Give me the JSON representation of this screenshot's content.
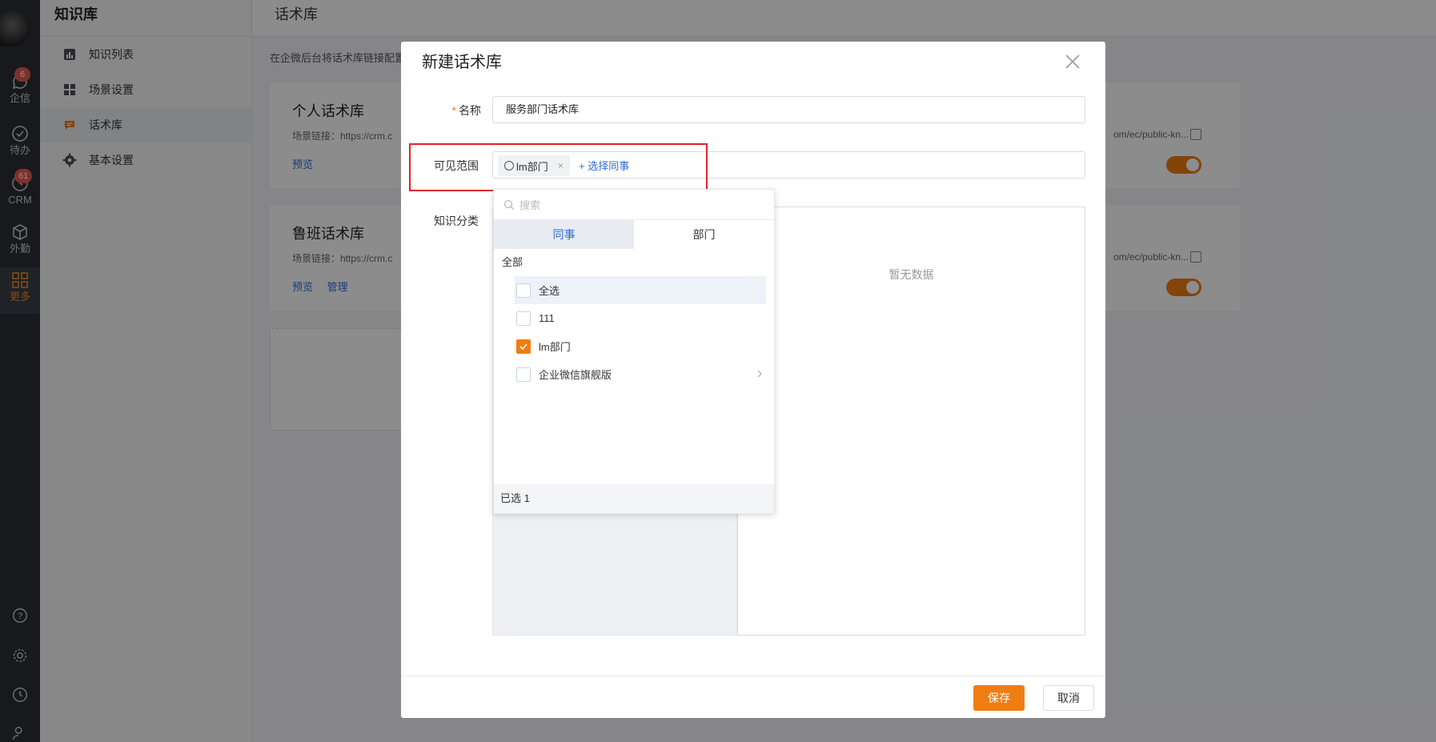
{
  "rail": {
    "items": [
      {
        "label": "企信",
        "icon": "chat-icon",
        "badge": "6"
      },
      {
        "label": "待办",
        "icon": "check-icon",
        "badge": ""
      },
      {
        "label": "CRM",
        "icon": "clock-icon",
        "badge": "61"
      },
      {
        "label": "外勤",
        "icon": "box-icon",
        "badge": ""
      },
      {
        "label": "更多",
        "icon": "grid-icon",
        "badge": ""
      }
    ]
  },
  "sidebar": {
    "title": "知识库",
    "items": [
      {
        "label": "知识列表",
        "icon": "chart-icon"
      },
      {
        "label": "场景设置",
        "icon": "layout-icon"
      },
      {
        "label": "话术库",
        "icon": "message-icon"
      },
      {
        "label": "基本设置",
        "icon": "gear-icon"
      }
    ]
  },
  "main": {
    "header": "话术库",
    "hint": "在企微后台将话术库链接配置",
    "cards": [
      {
        "title": "个人话术库",
        "link_left": "场景链接：https://crm.c",
        "link_right": "om/ec/public-kn...",
        "actions": [
          "预览"
        ]
      },
      {
        "title": "鲁班话术库",
        "link_left": "场景链接：https://crm.c",
        "link_right": "om/ec/public-kn...",
        "actions": [
          "预览",
          "管理"
        ]
      }
    ]
  },
  "modal": {
    "title": "新建话术库",
    "name_label": "名称",
    "name_required": "*",
    "name_value": "服务部门话术库",
    "scope_label": "可见范围",
    "scope_tag": "lm部门",
    "scope_tag_remove": "×",
    "scope_add": "+ 选择同事",
    "category_label": "知识分类",
    "empty_text": "暂无数据",
    "save_label": "保存",
    "cancel_label": "取消"
  },
  "dropdown": {
    "search_placeholder": "搜索",
    "tabs": [
      "同事",
      "部门"
    ],
    "all_label": "全部",
    "options": [
      {
        "label": "全选",
        "checked": false,
        "has_children": false
      },
      {
        "label": "111",
        "checked": false,
        "has_children": false
      },
      {
        "label": "lm部门",
        "checked": true,
        "has_children": false
      },
      {
        "label": "企业微信旗舰版",
        "checked": false,
        "has_children": true
      }
    ],
    "footer": "已选 1"
  },
  "colors": {
    "accent": "#f07d12",
    "link": "#2e6bd9",
    "highlight_box": "#e2222b",
    "rail_bg": "#2b2f36"
  }
}
